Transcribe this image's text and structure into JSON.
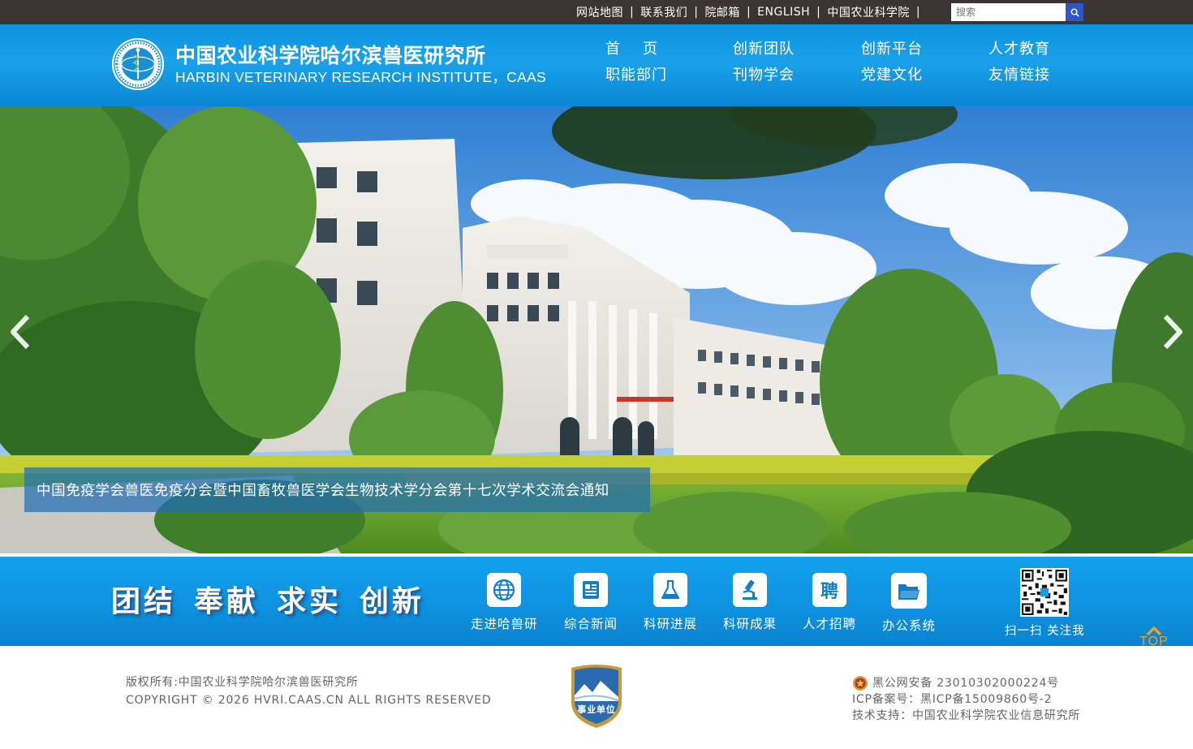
{
  "topbar": {
    "links": [
      "网站地图",
      "联系我们",
      "院邮箱",
      "ENGLISH",
      "中国农业科学院"
    ],
    "separator": "|",
    "search_placeholder": "搜索"
  },
  "header": {
    "logo_cn": "中国农业科学院哈尔滨兽医研究所",
    "logo_en": "HARBIN VETERINARY RESEARCH INSTITUTE，CAAS",
    "nav": [
      "首页",
      "创新团队",
      "创新平台",
      "人才教育",
      "职能部门",
      "刊物学会",
      "党建文化",
      "友情链接"
    ]
  },
  "banner": {
    "caption": "中国免疫学会兽医免疫分会暨中国畜牧兽医学会生物技术学分会第十七次学术交流会通知",
    "prev_glyph": "‹",
    "next_glyph": "›"
  },
  "band": {
    "slogan": [
      "团结",
      "奉献",
      "求实",
      "创新"
    ],
    "links": [
      {
        "label": "走进哈兽研",
        "icon": "globe-icon"
      },
      {
        "label": "综合新闻",
        "icon": "newspaper-icon"
      },
      {
        "label": "科研进展",
        "icon": "flask-icon"
      },
      {
        "label": "科研成果",
        "icon": "microscope-icon"
      },
      {
        "label": "人才招聘",
        "icon": "recruit-icon",
        "glyph": "聘"
      },
      {
        "label": "办公系统",
        "icon": "folder-icon"
      }
    ],
    "qr_label": "扫一扫 关注我"
  },
  "top_button": "TOP",
  "footer": {
    "copyright_cn": "版权所有:中国农业科学院哈尔滨兽医研究所",
    "copyright_en": "COPYRIGHT © 2026 HVRI.CAAS.CN ALL RIGHTS RESERVED",
    "badge_text": "事业单位",
    "police_record": "黑公网安备 23010302000224号",
    "icp": "ICP备案号：黑ICP备15009860号-2",
    "tech_support": "技术支持：中国农业科学院农业信息研究所"
  },
  "colors": {
    "topbar_bg": "#3b3433",
    "header_blue": "#1aa1ea",
    "band_blue": "#0f94e2",
    "caption_bg": "#216eb4",
    "top_button": "#f0a020",
    "search_button": "#2f56c4"
  }
}
